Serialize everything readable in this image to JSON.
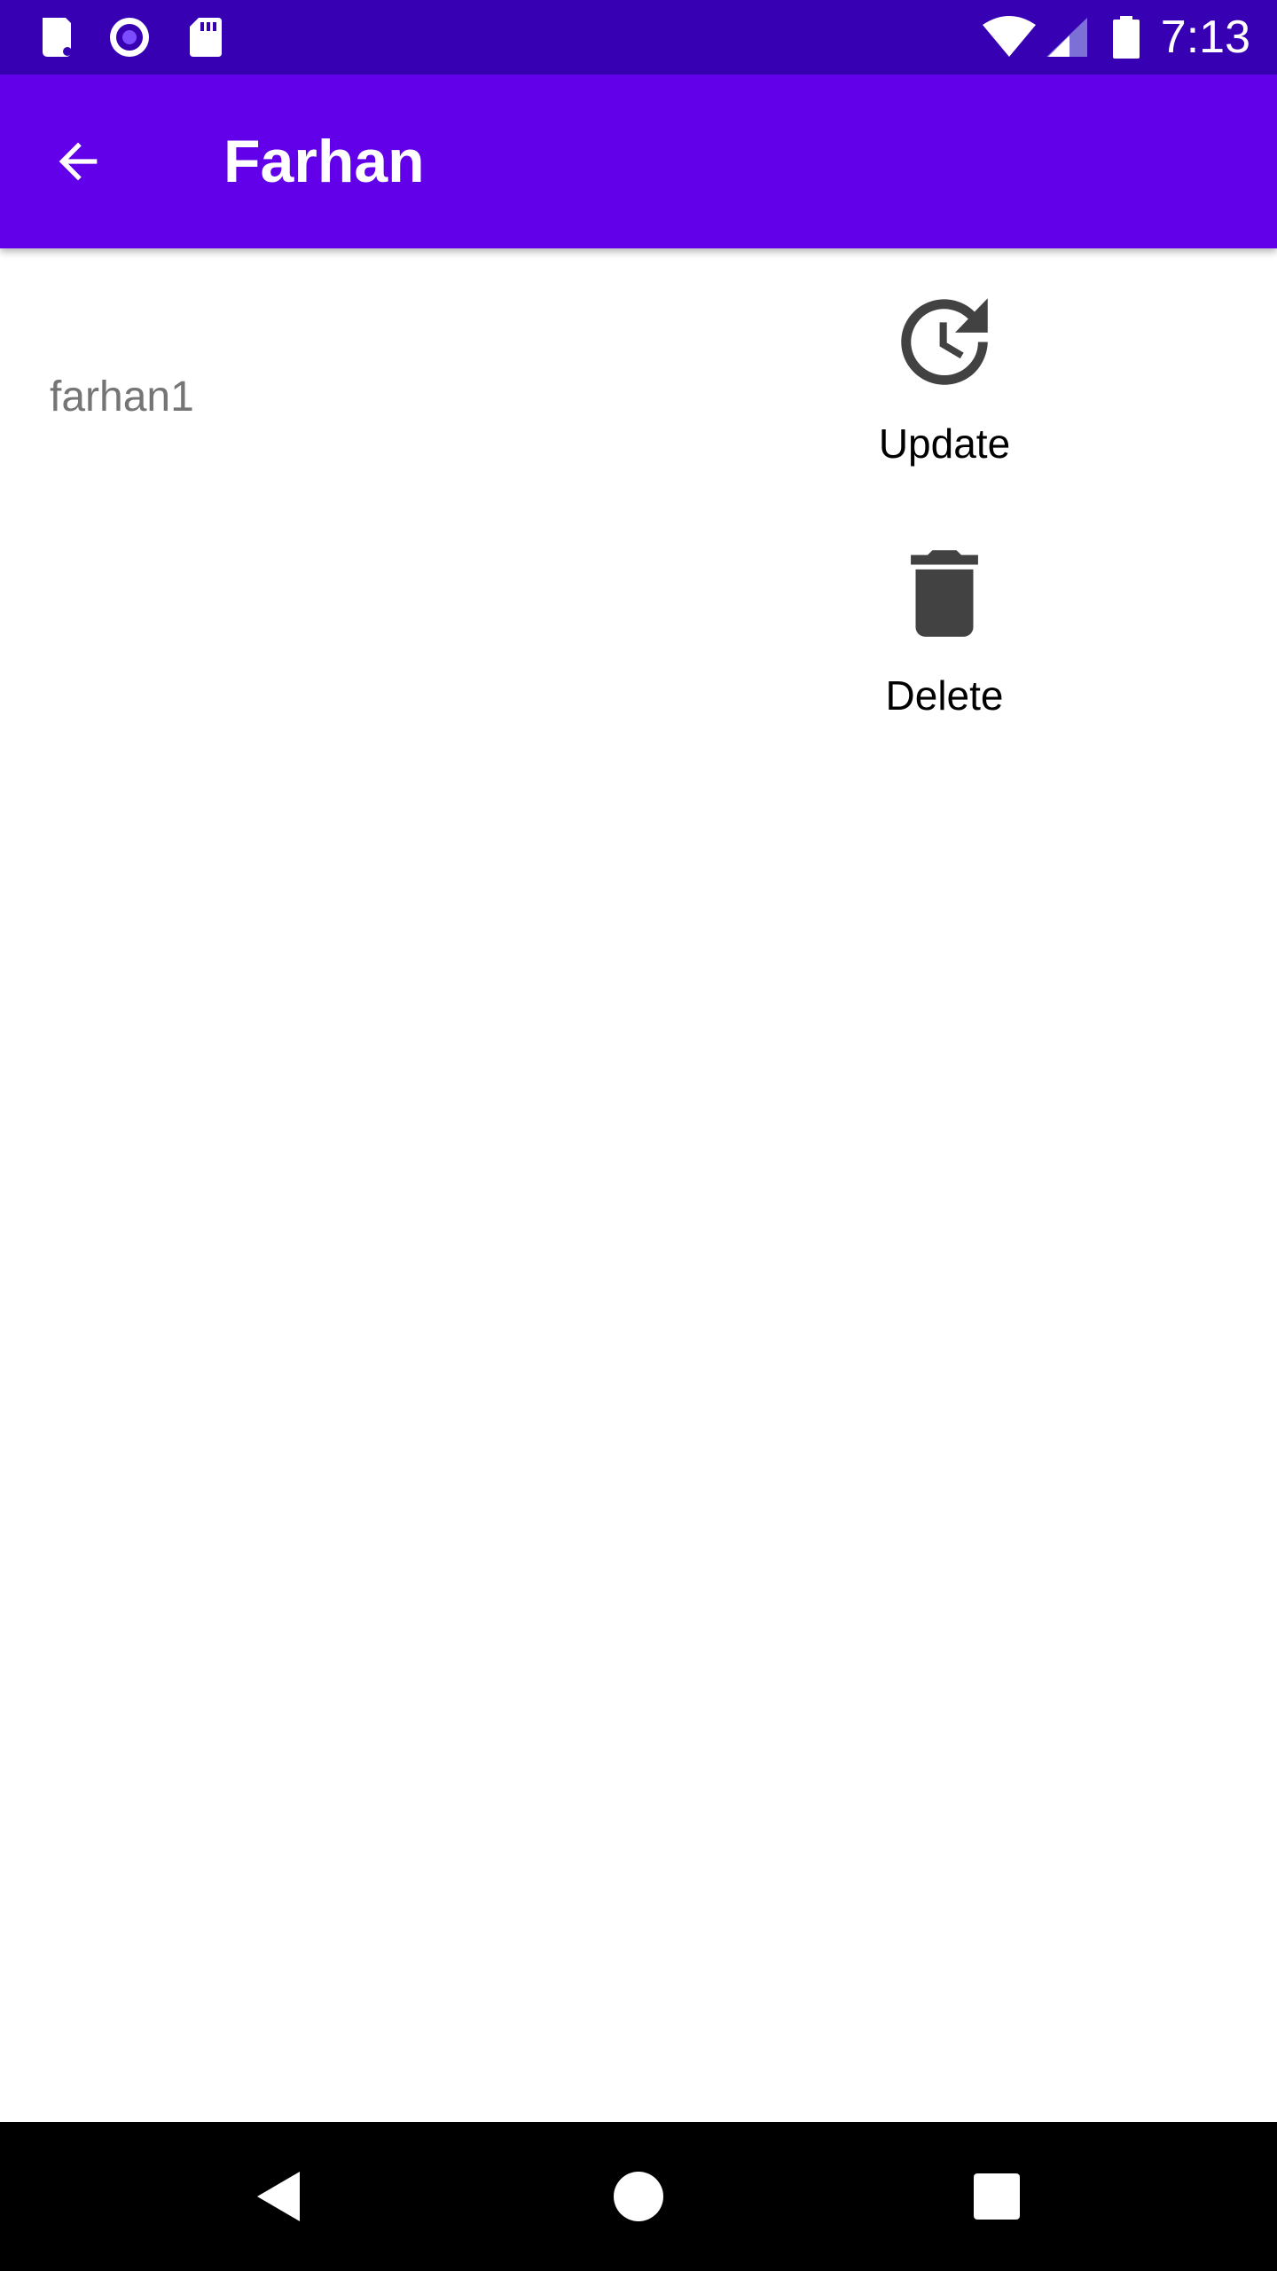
{
  "status_bar": {
    "time": "7:13",
    "left_icons": [
      "sim-card-icon",
      "radio-record-icon",
      "sd-card-icon"
    ],
    "right_icons": [
      "wifi-icon",
      "cell-signal-icon",
      "battery-icon"
    ]
  },
  "app_bar": {
    "title": "Farhan",
    "back_icon": "arrow-back-icon",
    "color": "#6200ea"
  },
  "content": {
    "item_text": "farhan1",
    "actions": [
      {
        "label": "Update",
        "icon": "update-icon"
      },
      {
        "label": "Delete",
        "icon": "delete-icon"
      }
    ]
  },
  "nav_bar": {
    "buttons": [
      "back-triangle-icon",
      "home-circle-icon",
      "recents-square-icon"
    ]
  },
  "colors": {
    "status_bar": "#3700b3",
    "app_bar": "#6200ea",
    "icon_dark": "#424242",
    "secondary_text": "#757575"
  }
}
